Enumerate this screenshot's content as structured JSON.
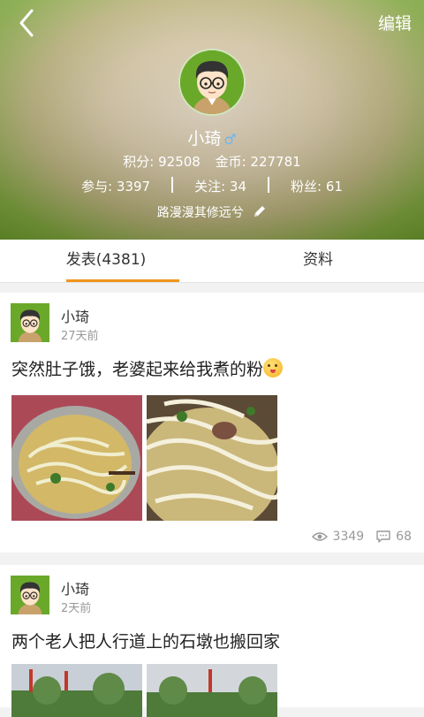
{
  "header": {
    "edit_label": "编辑",
    "name": "小琦",
    "gender_symbol": "♂",
    "points": "积分: 92508",
    "coins": "金币: 227781",
    "participate": "参与: 3397",
    "following": "关注: 34",
    "fans": "粉丝: 61",
    "signature": "路漫漫其修远兮"
  },
  "tabs": [
    {
      "label": "发表(4381)",
      "active": true
    },
    {
      "label": "资料",
      "active": false
    }
  ],
  "posts": [
    {
      "author": "小琦",
      "time": "27天前",
      "content": "突然肚子饿，老婆起来给我煮的粉",
      "views": "3349",
      "comments": "68"
    },
    {
      "author": "小琦",
      "time": "2天前",
      "content": "两个老人把人行道上的石墩也搬回家"
    }
  ],
  "colors": {
    "accent": "#f0961e",
    "header_green": "#6c9a2c",
    "gender_blue": "#6fb7ef"
  }
}
